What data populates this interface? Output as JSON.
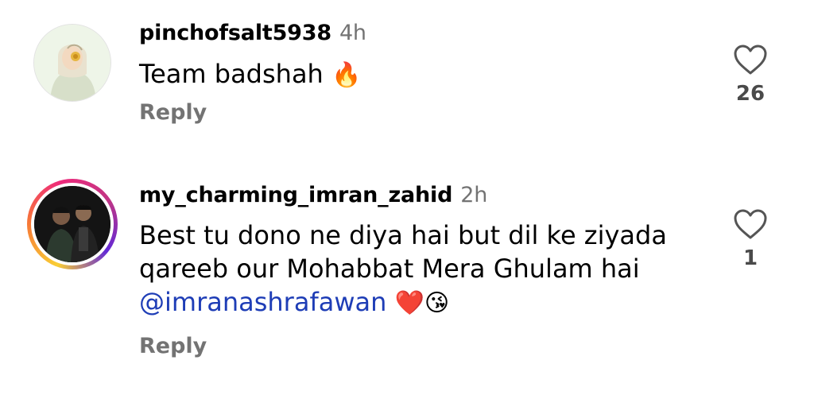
{
  "comments": [
    {
      "username": "pinchofsalt5938",
      "time": "4h",
      "text": "Team badshah",
      "emoji": "🔥",
      "reply_label": "Reply",
      "like_count": "26"
    },
    {
      "username": "my_charming_imran_zahid",
      "time": "2h",
      "text_line1": "Best tu dono ne diya hai but dil ke ziyada",
      "text_line2": "qareeb our Mohabbat  Mera Ghulam hai",
      "mention": "@imranashrafawan",
      "emojis": "❤️😘",
      "reply_label": "Reply",
      "like_count": "1",
      "has_story_ring": true
    }
  ],
  "icons": {
    "like": "heart-outline-icon"
  },
  "colors": {
    "username": "#000000",
    "secondary": "#737373",
    "mention": "#1e3db6"
  }
}
